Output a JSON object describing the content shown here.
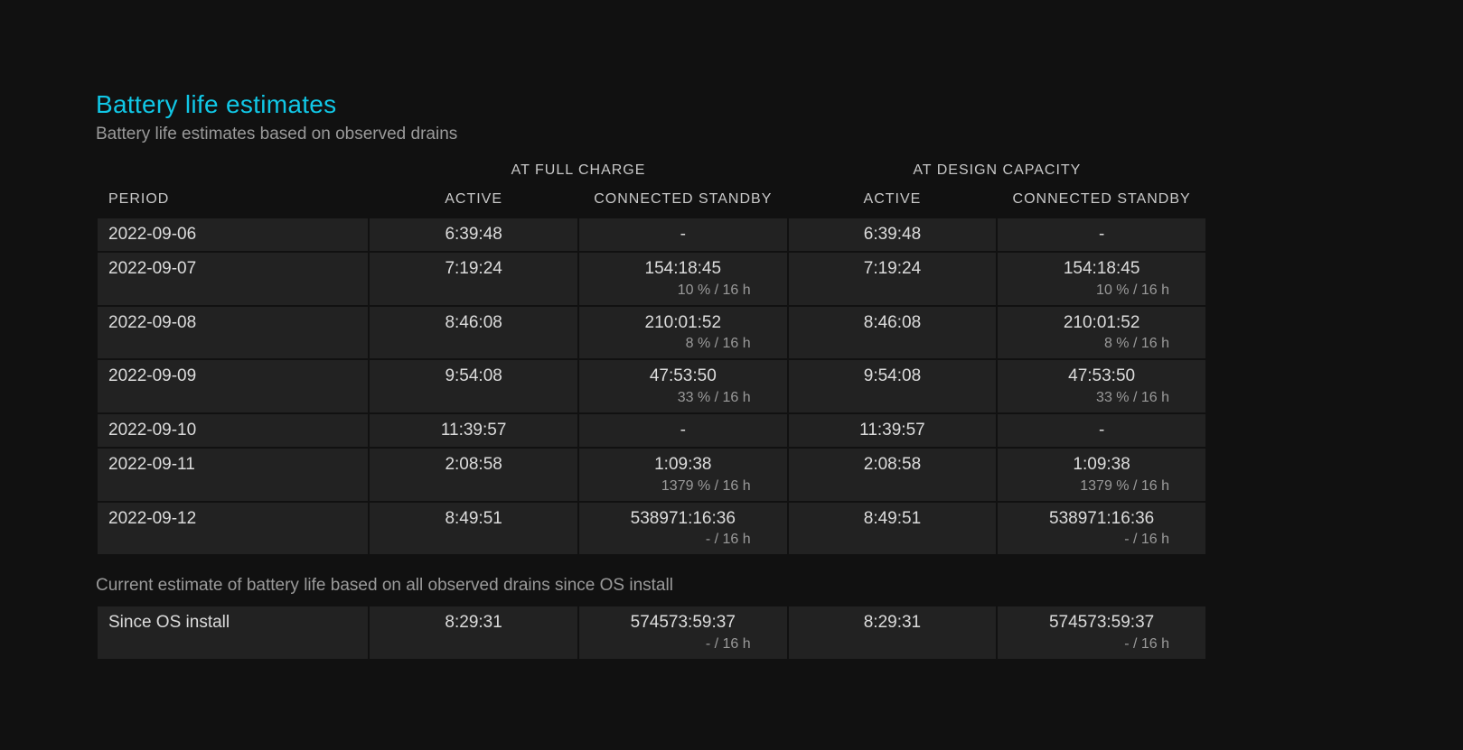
{
  "title": "Battery life estimates",
  "subtitle": "Battery life estimates based on observed drains",
  "subtitle2": "Current estimate of battery life based on all observed drains since OS install",
  "headers": {
    "period": "PERIOD",
    "full_charge": "AT FULL CHARGE",
    "design_capacity": "AT DESIGN CAPACITY",
    "active": "ACTIVE",
    "connected_standby": "CONNECTED STANDBY"
  },
  "rows": [
    {
      "period": "2022-09-06",
      "fc_active": "6:39:48",
      "fc_cs": "-",
      "fc_cs_sub": "",
      "dc_active": "6:39:48",
      "dc_cs": "-",
      "dc_cs_sub": ""
    },
    {
      "period": "2022-09-07",
      "fc_active": "7:19:24",
      "fc_cs": "154:18:45",
      "fc_cs_sub": "10 % / 16 h",
      "dc_active": "7:19:24",
      "dc_cs": "154:18:45",
      "dc_cs_sub": "10 % / 16 h"
    },
    {
      "period": "2022-09-08",
      "fc_active": "8:46:08",
      "fc_cs": "210:01:52",
      "fc_cs_sub": "8 % / 16 h",
      "dc_active": "8:46:08",
      "dc_cs": "210:01:52",
      "dc_cs_sub": "8 % / 16 h"
    },
    {
      "period": "2022-09-09",
      "fc_active": "9:54:08",
      "fc_cs": "47:53:50",
      "fc_cs_sub": "33 % / 16 h",
      "dc_active": "9:54:08",
      "dc_cs": "47:53:50",
      "dc_cs_sub": "33 % / 16 h"
    },
    {
      "period": "2022-09-10",
      "fc_active": "11:39:57",
      "fc_cs": "-",
      "fc_cs_sub": "",
      "dc_active": "11:39:57",
      "dc_cs": "-",
      "dc_cs_sub": ""
    },
    {
      "period": "2022-09-11",
      "fc_active": "2:08:58",
      "fc_cs": "1:09:38",
      "fc_cs_sub": "1379 % / 16 h",
      "dc_active": "2:08:58",
      "dc_cs": "1:09:38",
      "dc_cs_sub": "1379 % / 16 h"
    },
    {
      "period": "2022-09-12",
      "fc_active": "8:49:51",
      "fc_cs": "538971:16:36",
      "fc_cs_sub": "- / 16 h",
      "dc_active": "8:49:51",
      "dc_cs": "538971:16:36",
      "dc_cs_sub": "- / 16 h"
    }
  ],
  "summary": {
    "period": "Since OS install",
    "fc_active": "8:29:31",
    "fc_cs": "574573:59:37",
    "fc_cs_sub": "- / 16 h",
    "dc_active": "8:29:31",
    "dc_cs": "574573:59:37",
    "dc_cs_sub": "- / 16 h"
  }
}
